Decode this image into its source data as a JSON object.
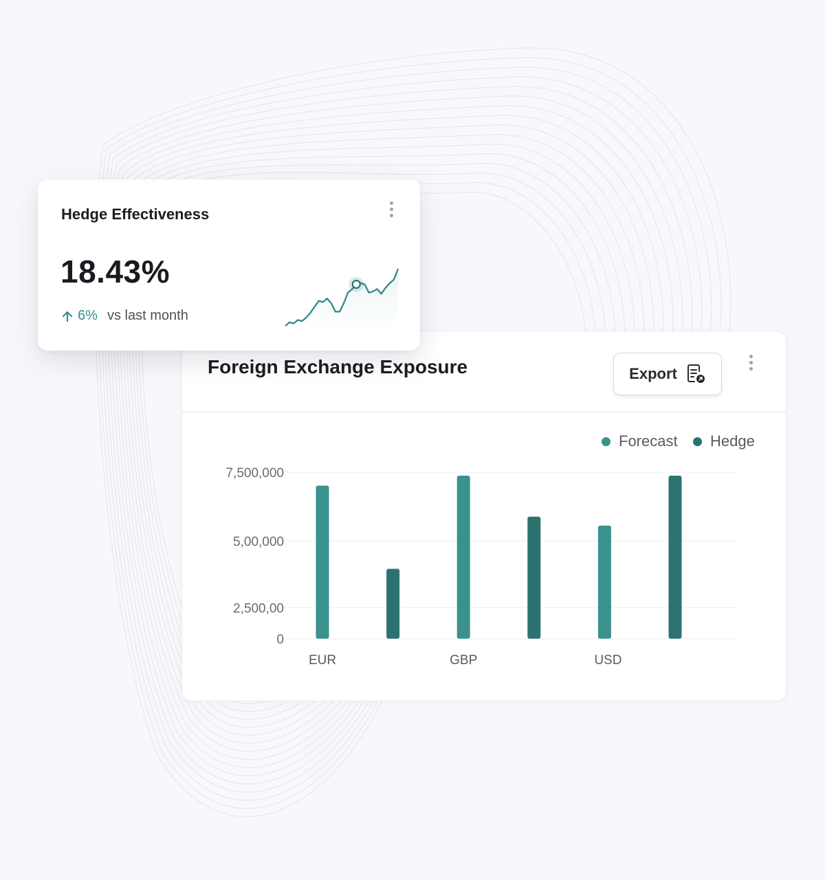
{
  "hedge_card": {
    "title": "Hedge Effectiveness",
    "value": "18.43%",
    "change": "6%",
    "compare_label": "vs last month"
  },
  "fx_card": {
    "title": "Foreign Exchange Exposure",
    "export_label": "Export"
  },
  "colors": {
    "forecast": "#3b918e",
    "hedge": "#2c7370",
    "accent": "#3a8c89"
  },
  "icons": [
    "more-vertical-icon",
    "arrow-up-icon",
    "export-report-icon"
  ],
  "chart_data": {
    "type": "bar",
    "legend_position": "top-right",
    "grid": true,
    "series": [
      {
        "name": "Forecast",
        "color": "#3b918e"
      },
      {
        "name": "Hedge",
        "color": "#2c7370"
      }
    ],
    "bars": [
      {
        "series": "Forecast",
        "value": 6900000
      },
      {
        "series": "Hedge",
        "value": 3150000
      },
      {
        "series": "Forecast",
        "value": 7350000
      },
      {
        "series": "Hedge",
        "value": 5500000
      },
      {
        "series": "Forecast",
        "value": 5100000
      },
      {
        "series": "Hedge",
        "value": 7350000
      }
    ],
    "x_tick_labels": [
      "EUR",
      "GBP",
      "USD"
    ],
    "y_tick_labels": [
      "7,500,000",
      "5,00,000",
      "2,500,00",
      "0"
    ],
    "y_ticks": [
      7500000,
      4400000,
      1400000,
      0
    ],
    "ylim": [
      0,
      7500000
    ]
  },
  "sparkline": {
    "values": [
      2,
      5,
      4,
      7,
      6,
      9,
      13,
      18,
      23,
      22,
      25,
      21,
      14,
      14,
      21,
      30,
      33,
      37,
      38,
      37,
      30,
      31,
      33,
      29,
      34,
      38,
      41,
      50
    ]
  }
}
